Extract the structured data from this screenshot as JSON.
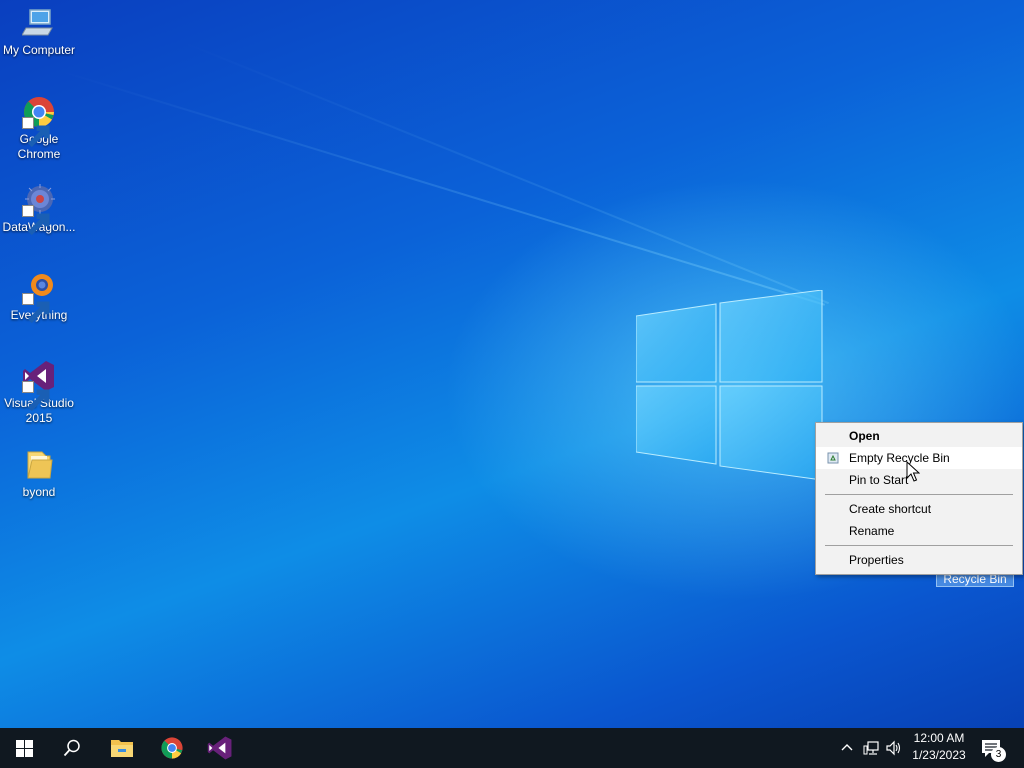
{
  "desktop": {
    "icons": [
      {
        "label": "My Computer",
        "icon": "computer-icon"
      },
      {
        "label": "Google\nChrome",
        "icon": "chrome-icon"
      },
      {
        "label": "DataWagon...",
        "icon": "datawagon-icon"
      },
      {
        "label": "Everything",
        "icon": "everything-search-icon"
      },
      {
        "label": "Visual Studio\n2015",
        "icon": "visual-studio-icon"
      },
      {
        "label": "byond",
        "icon": "folder-icon"
      }
    ],
    "selected_icon_label": "Recycle Bin"
  },
  "context_menu": {
    "items": [
      {
        "label": "Open",
        "bold": true
      },
      {
        "label": "Empty Recycle Bin",
        "icon": "recycle-bin-icon",
        "hovered": true
      },
      {
        "label": "Pin to Start"
      },
      {
        "label": "Create shortcut"
      },
      {
        "label": "Rename"
      },
      {
        "label": "Properties"
      }
    ]
  },
  "taskbar": {
    "pinned": [
      {
        "name": "start",
        "icon": "windows-icon"
      },
      {
        "name": "search",
        "icon": "search-icon"
      },
      {
        "name": "file-explorer",
        "icon": "folder-icon"
      },
      {
        "name": "chrome",
        "icon": "chrome-icon"
      },
      {
        "name": "visual-studio",
        "icon": "visual-studio-icon"
      }
    ],
    "tray": {
      "time": "12:00 AM",
      "date": "1/23/2023",
      "notification_count": "3"
    }
  },
  "colors": {
    "desktop_blue": "#0b62d8",
    "taskbar": "#101820",
    "menu_bg": "#f2f2f2",
    "vs_purple": "#68217a"
  }
}
